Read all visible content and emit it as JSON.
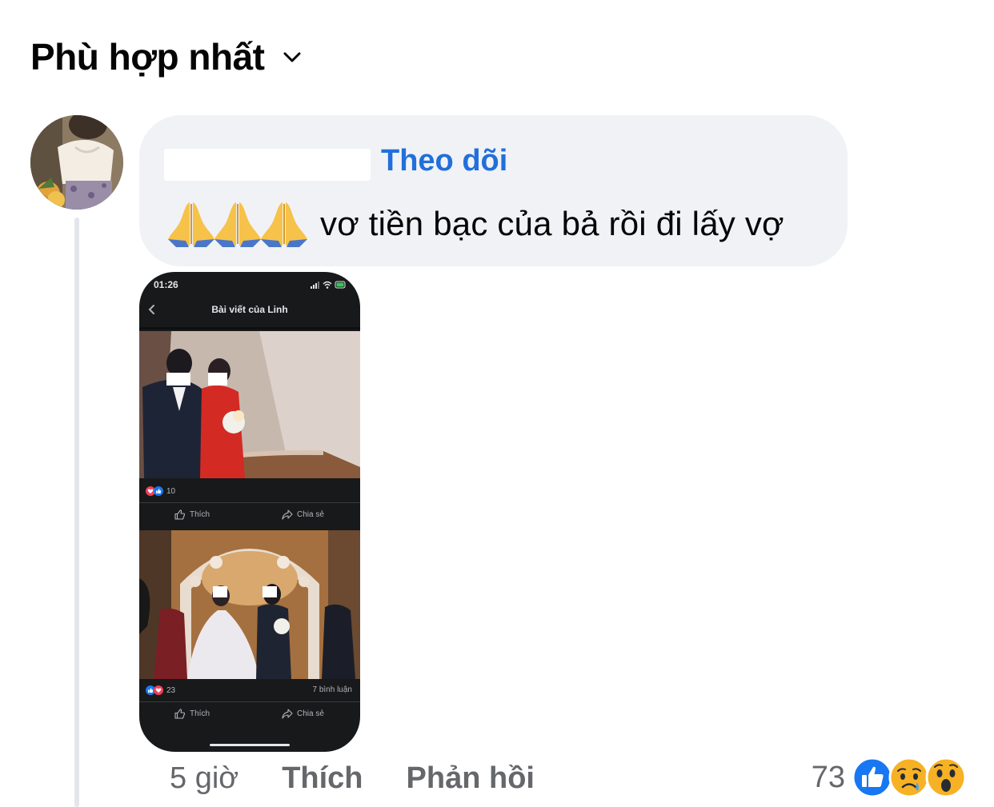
{
  "header": {
    "sort_label": "Phù hợp nhất"
  },
  "comment": {
    "follow_label": "Theo dõi",
    "text": "vơ tiền bạc của bả rồi đi lấy vợ",
    "footer": {
      "time": "5 giờ",
      "like_label": "Thích",
      "reply_label": "Phản hồi"
    },
    "reaction_count": "73",
    "reactions": [
      "like-reaction-icon",
      "sad-reaction-icon",
      "wow-reaction-icon"
    ]
  },
  "screenshot": {
    "status_time": "01:26",
    "nav_title": "Bài viết của Linh",
    "post1": {
      "reaction_count": "10",
      "like_label": "Thích",
      "share_label": "Chia sẻ"
    },
    "post2": {
      "reaction_count": "23",
      "comment_count": "7 bình luận",
      "like_label": "Thích",
      "share_label": "Chia sẻ"
    }
  },
  "colors": {
    "follow_link": "#216fdb",
    "bubble_bg": "#f0f2f5",
    "meta_text": "#65676b",
    "like_blue": "#1877f2"
  }
}
